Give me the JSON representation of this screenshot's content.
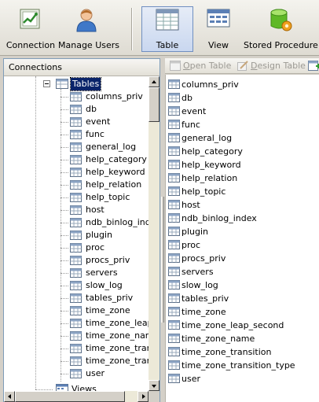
{
  "toolbar": {
    "buttons": [
      {
        "id": "connection",
        "label": "Connection",
        "icon": "connection-icon"
      },
      {
        "id": "manage-users",
        "label": "Manage Users",
        "icon": "user-icon"
      },
      {
        "id": "table",
        "label": "Table",
        "icon": "table-icon",
        "active": true
      },
      {
        "id": "view",
        "label": "View",
        "icon": "view-icon"
      },
      {
        "id": "stored-procedure",
        "label": "Stored Procedure",
        "icon": "stored-procedure-icon"
      }
    ]
  },
  "connections": {
    "header": "Connections",
    "tables_node": "Tables",
    "views_node": "Views",
    "tree_items": [
      "columns_priv",
      "db",
      "event",
      "func",
      "general_log",
      "help_category",
      "help_keyword",
      "help_relation",
      "help_topic",
      "host",
      "ndb_binlog_index",
      "plugin",
      "proc",
      "procs_priv",
      "servers",
      "slow_log",
      "tables_priv",
      "time_zone",
      "time_zone_leap_",
      "time_zone_name",
      "time_zone_trans",
      "time_zone_trans",
      "user"
    ]
  },
  "object_toolbar": {
    "open_prefix": "",
    "open_u": "O",
    "open_rest": "pen Table",
    "design_u": "D",
    "design_rest": "esign Table"
  },
  "object_list": {
    "items": [
      "columns_priv",
      "db",
      "event",
      "func",
      "general_log",
      "help_category",
      "help_keyword",
      "help_relation",
      "help_topic",
      "host",
      "ndb_binlog_index",
      "plugin",
      "proc",
      "procs_priv",
      "servers",
      "slow_log",
      "tables_priv",
      "time_zone",
      "time_zone_leap_second",
      "time_zone_name",
      "time_zone_transition",
      "time_zone_transition_type",
      "user"
    ]
  },
  "colors": {
    "selection": "#0a246a",
    "disabled_text": "#9c9a94",
    "active_button": "#c9d7ef"
  }
}
